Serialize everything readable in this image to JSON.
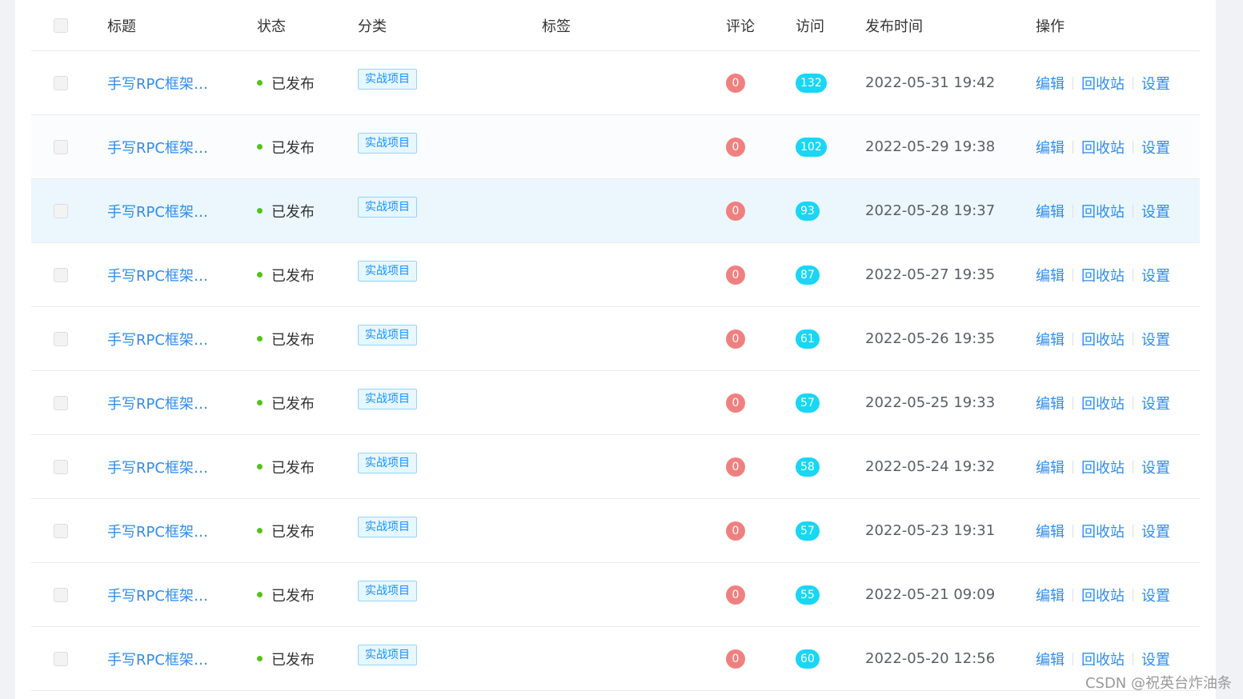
{
  "header": {
    "title": "标题",
    "status": "状态",
    "category": "分类",
    "tags": "标签",
    "comments": "评论",
    "visits": "访问",
    "publish_time": "发布时间",
    "actions": "操作"
  },
  "rows": [
    {
      "title": "手写RPC框架（...",
      "status": "已发布",
      "category": "实战项目",
      "comments": "0",
      "visits": "132",
      "time": "2022-05-31 19:42"
    },
    {
      "title": "手写RPC框架（...",
      "status": "已发布",
      "category": "实战项目",
      "comments": "0",
      "visits": "102",
      "time": "2022-05-29 19:38"
    },
    {
      "title": "手写RPC框架（...",
      "status": "已发布",
      "category": "实战项目",
      "comments": "0",
      "visits": "93",
      "time": "2022-05-28 19:37"
    },
    {
      "title": "手写RPC框架（...",
      "status": "已发布",
      "category": "实战项目",
      "comments": "0",
      "visits": "87",
      "time": "2022-05-27 19:35"
    },
    {
      "title": "手写RPC框架（...",
      "status": "已发布",
      "category": "实战项目",
      "comments": "0",
      "visits": "61",
      "time": "2022-05-26 19:35"
    },
    {
      "title": "手写RPC框架（...",
      "status": "已发布",
      "category": "实战项目",
      "comments": "0",
      "visits": "57",
      "time": "2022-05-25 19:33"
    },
    {
      "title": "手写RPC框架（...",
      "status": "已发布",
      "category": "实战项目",
      "comments": "0",
      "visits": "58",
      "time": "2022-05-24 19:32"
    },
    {
      "title": "手写RPC框架（...",
      "status": "已发布",
      "category": "实战项目",
      "comments": "0",
      "visits": "57",
      "time": "2022-05-23 19:31"
    },
    {
      "title": "手写RPC框架（...",
      "status": "已发布",
      "category": "实战项目",
      "comments": "0",
      "visits": "55",
      "time": "2022-05-21 09:09"
    },
    {
      "title": "手写RPC框架（...",
      "status": "已发布",
      "category": "实战项目",
      "comments": "0",
      "visits": "60",
      "time": "2022-05-20 12:56"
    }
  ],
  "actions": {
    "edit": "编辑",
    "recycle": "回收站",
    "settings": "设置"
  },
  "watermark": "CSDN @祝英台炸油条",
  "colors": {
    "link": "#2d8cf0",
    "status_dot": "#52c41a",
    "comment_badge": "#f08080",
    "visit_badge": "#19d6f5",
    "hover_row": "#ebf7fd"
  }
}
